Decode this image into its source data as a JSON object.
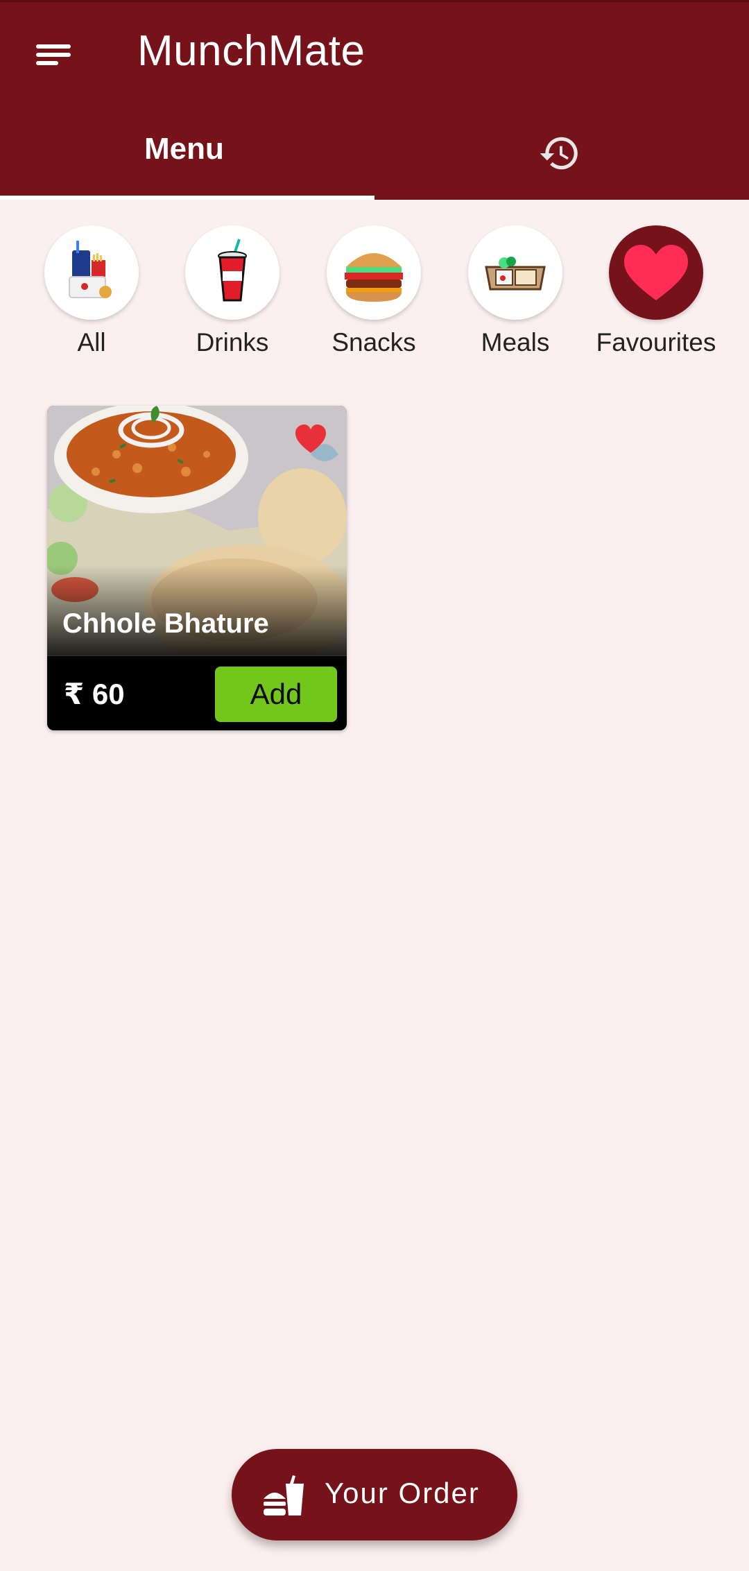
{
  "app": {
    "title": "MunchMate"
  },
  "tabs": [
    {
      "label": "Menu",
      "selected": true
    },
    {
      "icon": "history-icon",
      "selected": false
    }
  ],
  "categories": [
    {
      "label": "All",
      "icon": "combo-meal-icon",
      "selected": false
    },
    {
      "label": "Drinks",
      "icon": "soda-cup-icon",
      "selected": false
    },
    {
      "label": "Snacks",
      "icon": "burger-icon",
      "selected": false
    },
    {
      "label": "Meals",
      "icon": "meal-tray-icon",
      "selected": false
    },
    {
      "label": "Favourites",
      "icon": "heart-icon",
      "selected": true
    }
  ],
  "items": [
    {
      "name": "Chhole Bhature",
      "price": "₹ 60",
      "favourite": true,
      "add_label": "Add"
    }
  ],
  "order_button": {
    "label": "Your Order",
    "icon": "food-order-icon"
  },
  "colors": {
    "primary": "#75121A",
    "background": "#FCEFEF",
    "add": "#72C61C",
    "heart": "#FF2D55"
  }
}
